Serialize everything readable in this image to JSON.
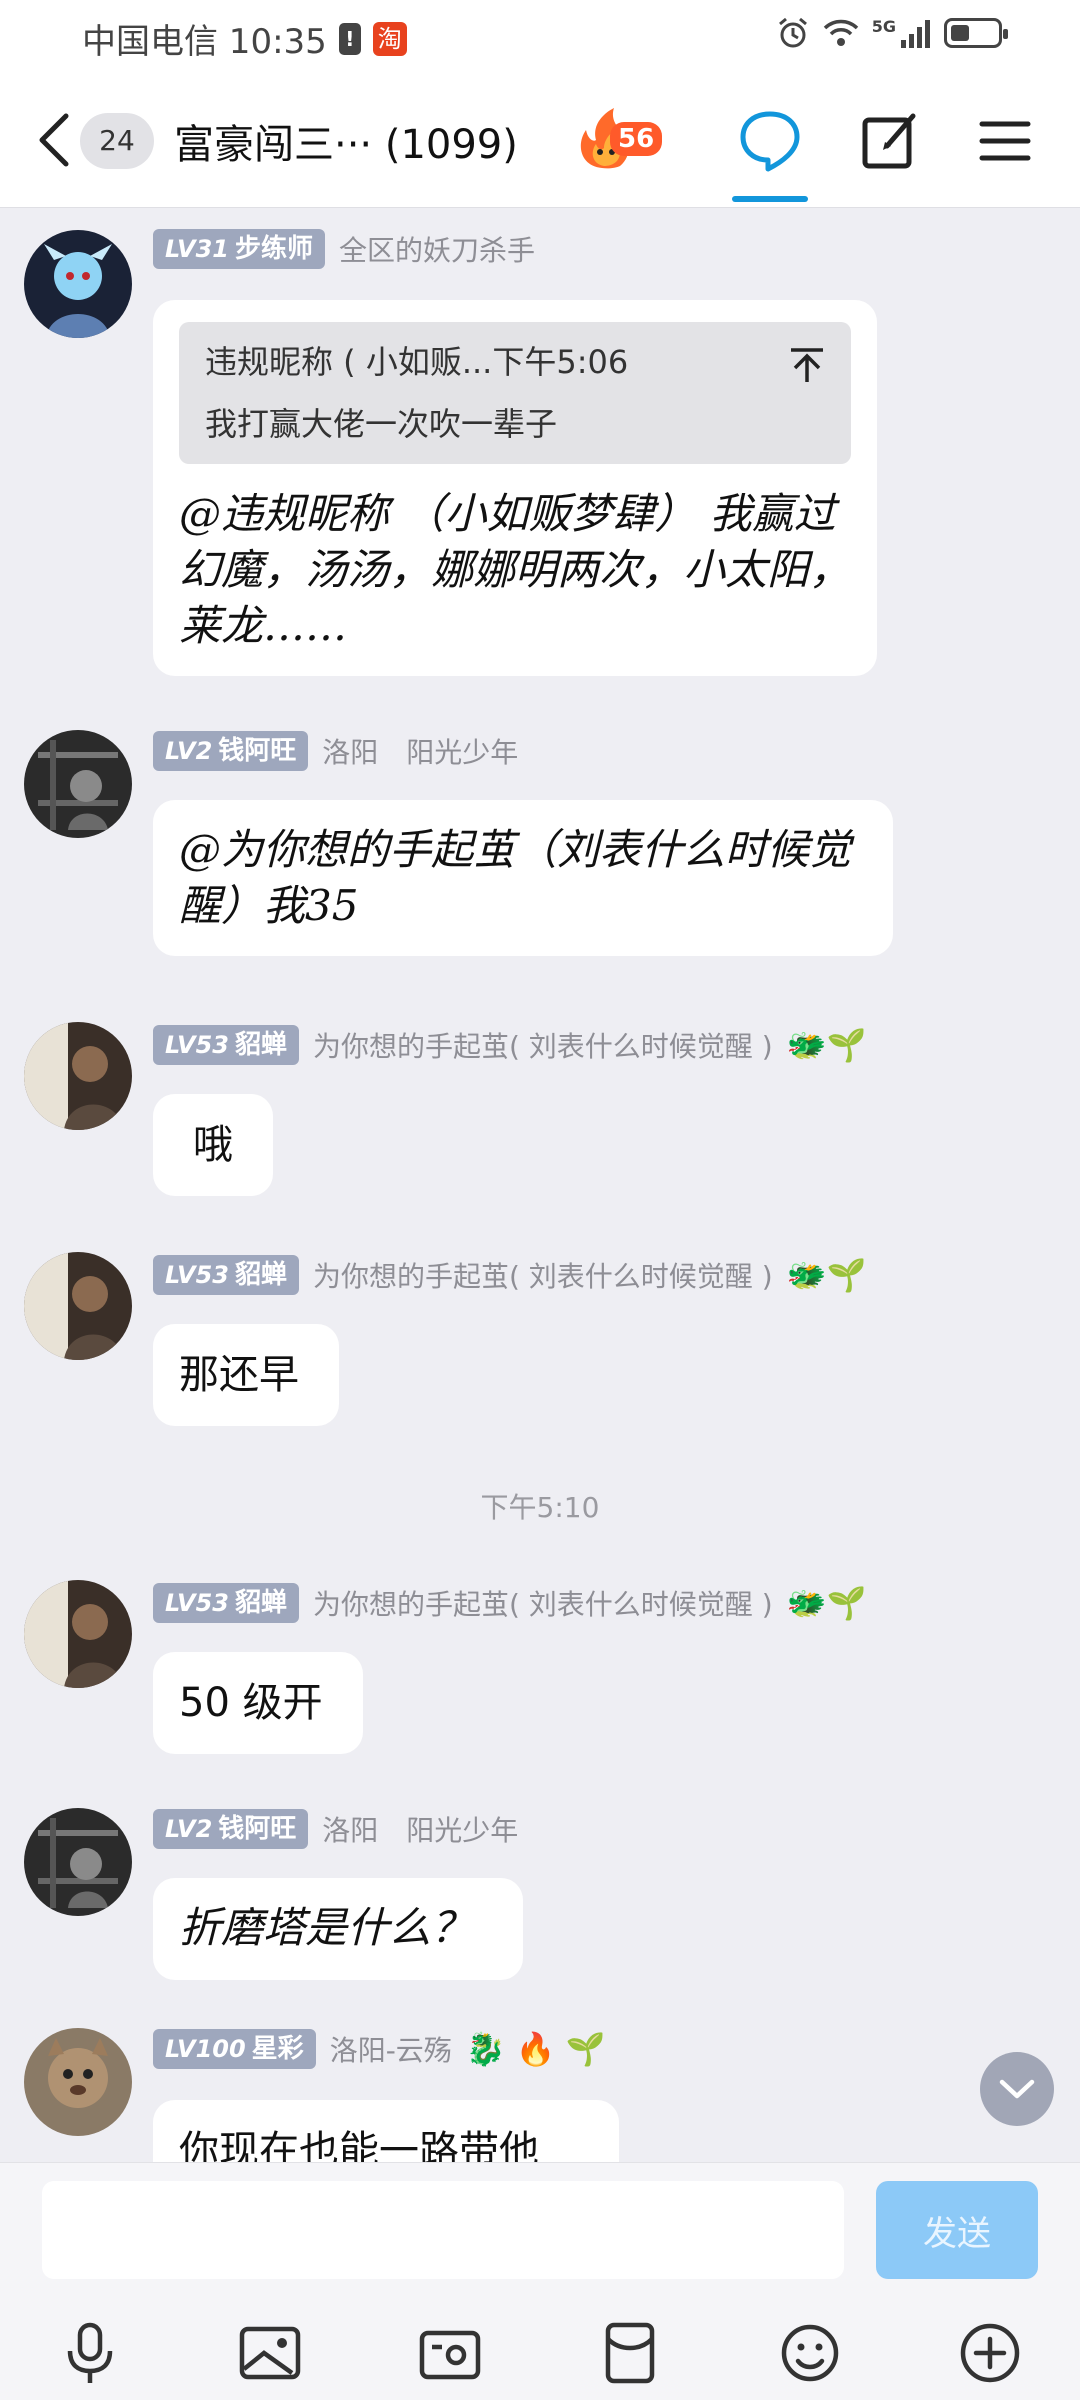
{
  "status_bar": {
    "carrier_time": "中国电信 10:35",
    "badge": "!",
    "tao_icon": "淘",
    "network": "5G"
  },
  "header": {
    "unread_count": "24",
    "group_title": "富豪闯三···  (1099)",
    "fire_level": "56"
  },
  "messages": [
    {
      "level": "LV31",
      "name": "步练师",
      "title": "全区的妖刀杀手",
      "quote_sender": "违规昵称 (  小如贩...下午5:06",
      "quote_text": "我打赢大佬一次吹一辈子",
      "text": "@违规昵称 （小如贩梦肆） 我赢过幻魔，汤汤，娜娜明两次，小太阳，莱龙……"
    },
    {
      "level": "LV2",
      "name": "钱阿旺",
      "title": "洛阳　阳光少年",
      "text": "@为你想的手起茧（刘表什么时候觉醒）我35"
    },
    {
      "level": "LV53",
      "name": "貂蝉",
      "title": "为你想的手起茧(  刘表什么时候觉醒 )",
      "emojis": "🐲🌱",
      "text": "哦"
    },
    {
      "level": "LV53",
      "name": "貂蝉",
      "title": "为你想的手起茧(  刘表什么时候觉醒 )",
      "emojis": "🐲🌱",
      "text": "那还早"
    },
    {
      "level": "LV53",
      "name": "貂蝉",
      "title": "为你想的手起茧(  刘表什么时候觉醒 )",
      "emojis": "🐲🌱",
      "text": "50 级开"
    },
    {
      "level": "LV2",
      "name": "钱阿旺",
      "title": "洛阳　阳光少年",
      "text": "折磨塔是什么？"
    },
    {
      "level": "LV100",
      "name": "星彩",
      "title": "洛阳-云殇",
      "emojis": "🐉 🔥 🌱",
      "text": "你现在也能一路带他"
    }
  ],
  "timestamp": "下午5:10",
  "input": {
    "placeholder": "",
    "send_label": "发送"
  }
}
